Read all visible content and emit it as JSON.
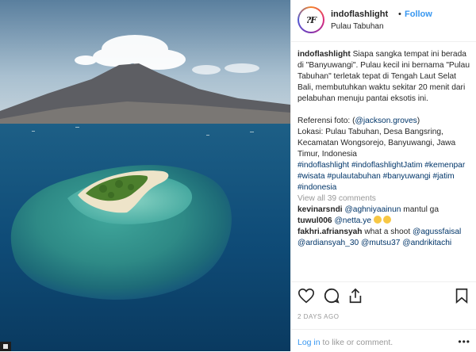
{
  "header": {
    "username": "indoflashlight",
    "dot": "•",
    "follow_label": "Follow",
    "location": "Pulau Tabuhan",
    "avatar_text": "?F"
  },
  "caption": {
    "username": "indoflashlight",
    "text": "Siapa sangka tempat ini berada di \"Banyuwangi\". Pulau kecil ini bernama \"Pulau Tabuhan\" terletak tepat di Tengah Laut Selat Bali, membutuhkan waktu sekitar 20 menit dari pelabuhan menuju pantai eksotis ini.",
    "ref_label": "Referensi foto: (",
    "ref_handle": "@jackson.groves",
    "ref_close": ")",
    "location_text": "Lokasi: Pulau Tabuhan, Desa Bangsring, Kecamatan Wongsorejo, Banyuwangi, Jawa Timur, Indonesia",
    "hashtags": "#indoflashlight #indoflashlightJatim #kemenpar #wisata #pulautabuhan #banyuwangi #jatim #indonesia"
  },
  "view_all": "View all 39 comments",
  "comments": [
    {
      "user": "kevinarsndi",
      "mention": "@aghniyaainun",
      "text": " mantul ga"
    },
    {
      "user": "tuwul006",
      "mention": "@netta.ye",
      "text": ""
    },
    {
      "user": "fakhri.afriansyah",
      "text": " what a shoot ",
      "mentions": "@agussfaisal @ardiansyah_30 @mutsu37 @andrikitachi"
    }
  ],
  "timestamp": "2 DAYS AGO",
  "login": {
    "link": "Log in",
    "rest": " to like or comment.",
    "more": "•••"
  },
  "icons": [
    "heart-icon",
    "comment-icon",
    "share-icon",
    "bookmark-icon"
  ],
  "colors": {
    "link": "#3897f0",
    "mention": "#003569",
    "muted": "#999999",
    "text": "#262626"
  }
}
